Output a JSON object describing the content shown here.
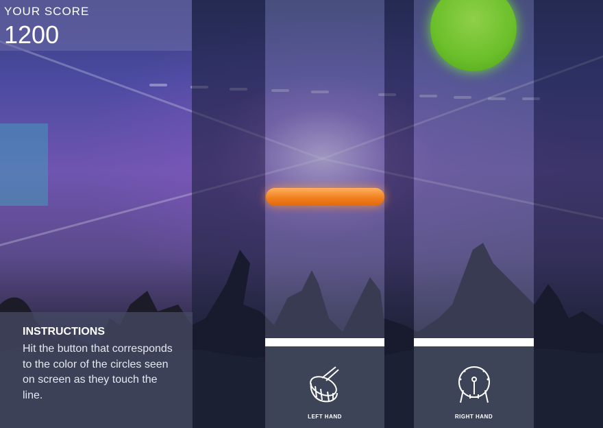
{
  "score": {
    "label": "YOUR SCORE",
    "value": "1200"
  },
  "instructions": {
    "title": "INSTRUCTIONS",
    "text": "Hit the button that corresponds to the color of the circles seen on screen as they touch the line."
  },
  "buttons": {
    "left": {
      "label": "LEFT HAND",
      "icon": "snare-drum-icon"
    },
    "right": {
      "label": "RIGHT HAND",
      "icon": "bass-drum-icon"
    }
  },
  "colors": {
    "orange_note": "#f07d1a",
    "green_note": "#6bbf2a",
    "hit_line": "#ffffff"
  }
}
